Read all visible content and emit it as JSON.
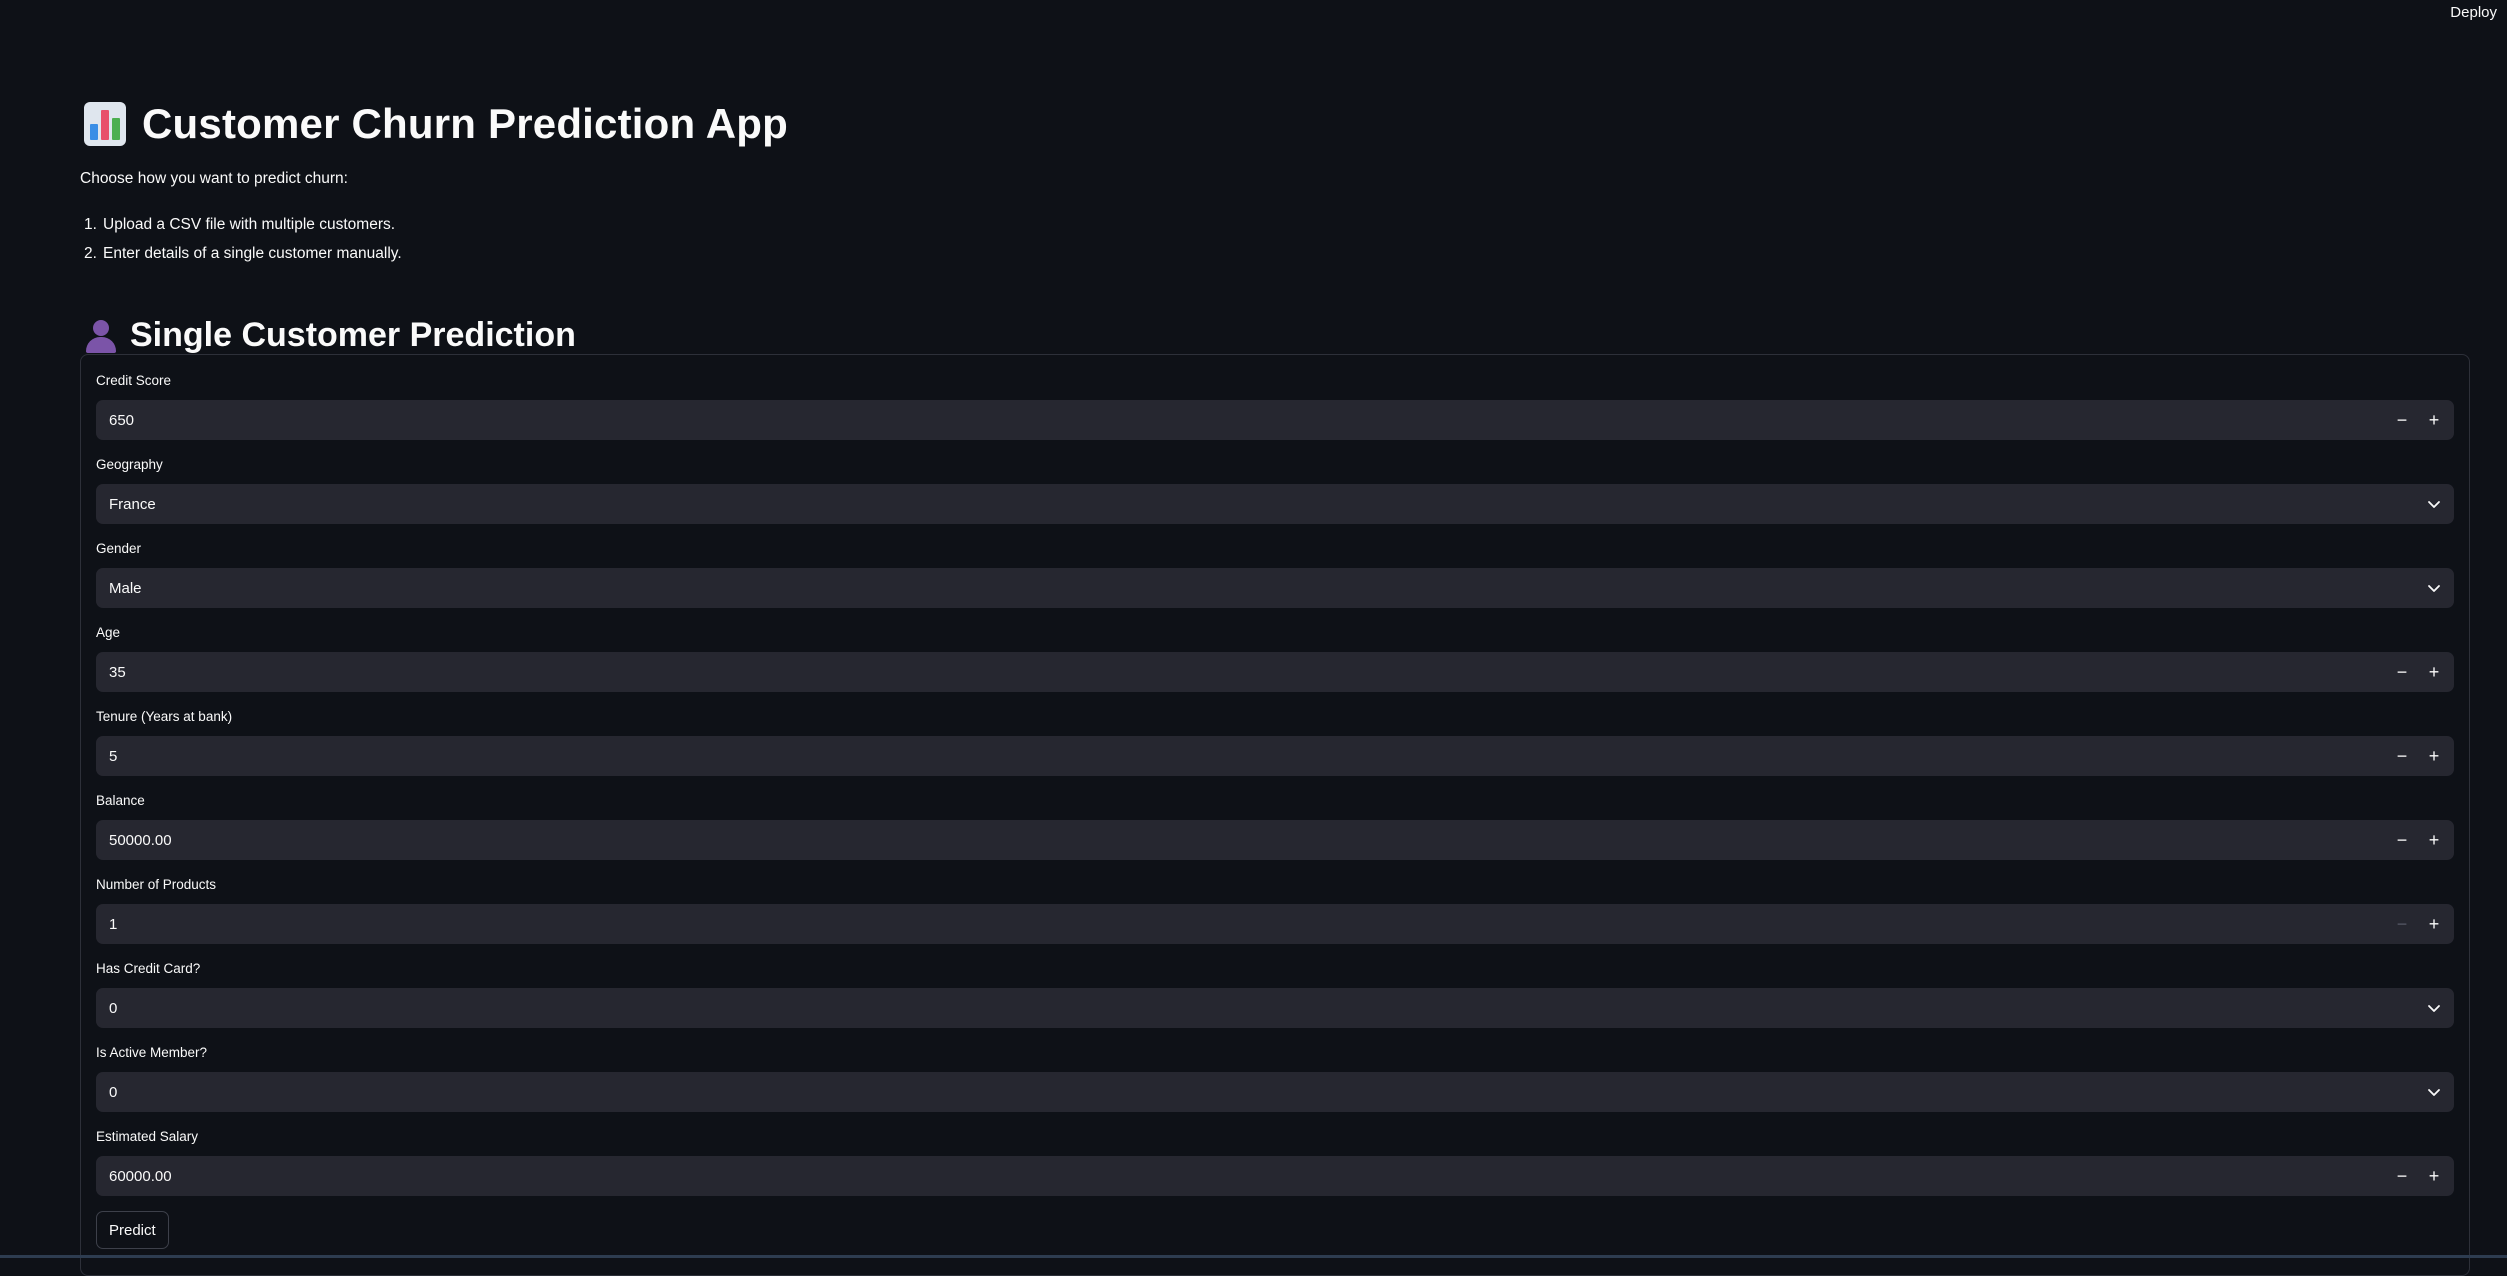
{
  "header": {
    "deploy_label": "Deploy"
  },
  "app": {
    "title": "Customer Churn Prediction App",
    "intro": "Choose how you want to predict churn:",
    "steps": [
      {
        "num": "1.",
        "text": "Upload a CSV file with multiple customers."
      },
      {
        "num": "2.",
        "text": "Enter details of a single customer manually."
      }
    ],
    "section_title": "Single Customer Prediction"
  },
  "form": {
    "fields": [
      {
        "label": "Credit Score",
        "value": "650",
        "kind": "number"
      },
      {
        "label": "Geography",
        "value": "France",
        "kind": "select"
      },
      {
        "label": "Gender",
        "value": "Male",
        "kind": "select"
      },
      {
        "label": "Age",
        "value": "35",
        "kind": "number"
      },
      {
        "label": "Tenure (Years at bank)",
        "value": "5",
        "kind": "number"
      },
      {
        "label": "Balance",
        "value": "50000.00",
        "kind": "number"
      },
      {
        "label": "Number of Products",
        "value": "1",
        "kind": "number",
        "minus_disabled": true
      },
      {
        "label": "Has Credit Card?",
        "value": "0",
        "kind": "select"
      },
      {
        "label": "Is Active Member?",
        "value": "0",
        "kind": "select"
      },
      {
        "label": "Estimated Salary",
        "value": "60000.00",
        "kind": "number"
      }
    ],
    "stepper_minus": "−",
    "stepper_plus": "+",
    "predict_label": "Predict"
  },
  "icons": {
    "title_icon": "bar-chart-emoji-icon",
    "section_icon": "person-silhouette-icon",
    "select_icon": "chevron-down-icon"
  },
  "colors": {
    "background": "#0e1117",
    "input_background": "#262730",
    "text": "#fafafa",
    "border": "#2d3039"
  }
}
